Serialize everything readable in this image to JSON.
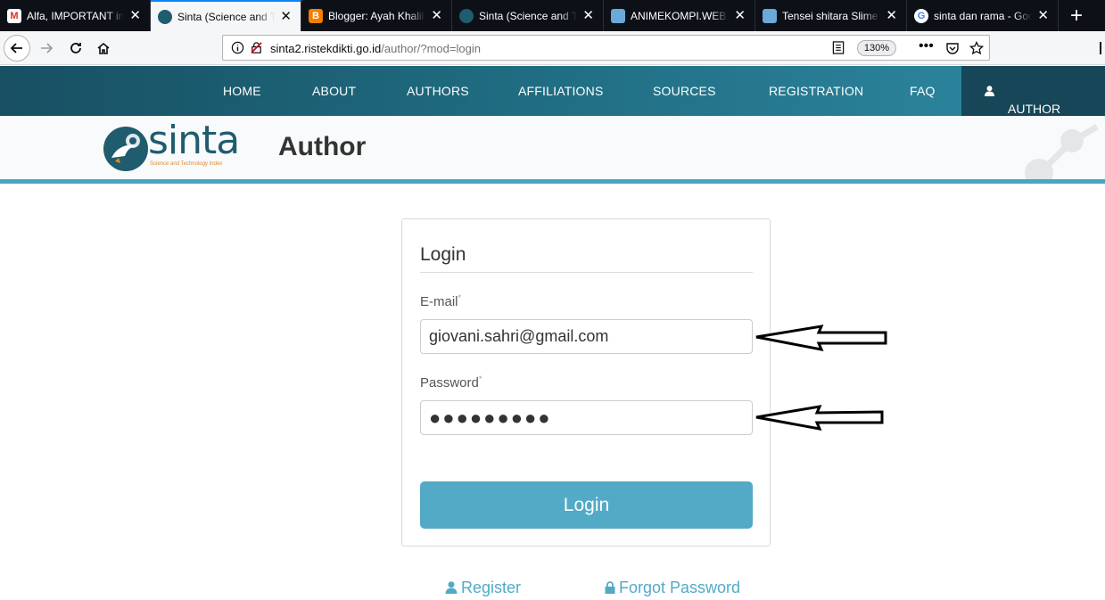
{
  "browser": {
    "tabs": [
      {
        "title": "Alfa, IMPORTANT in",
        "favicon": "gmail-icon",
        "active": false
      },
      {
        "title": "Sinta (Science and Te",
        "favicon": "sinta-icon",
        "active": true
      },
      {
        "title": "Blogger: Ayah Khalil",
        "favicon": "blogger-icon",
        "active": false
      },
      {
        "title": "Sinta (Science and Te",
        "favicon": "sinta-icon",
        "active": false
      },
      {
        "title": "ANIMEKOMPI.WEB.ID",
        "favicon": "site-icon",
        "active": false
      },
      {
        "title": "Tensei shitara Slime D",
        "favicon": "site-icon",
        "active": false
      },
      {
        "title": "sinta dan rama - Goo",
        "favicon": "google-icon",
        "active": false
      }
    ],
    "url_domain": "sinta2.ristekdikti.go.id",
    "url_path": "/author/?mod=login",
    "zoom": "130%"
  },
  "site": {
    "nav": [
      "HOME",
      "ABOUT",
      "AUTHORS",
      "AFFILIATIONS",
      "SOURCES",
      "REGISTRATION",
      "FAQ"
    ],
    "author_login": "AUTHOR LOGIN",
    "logo_text": "sinta",
    "logo_sub": "Science and Technology Index",
    "page_title": "Author"
  },
  "login": {
    "heading": "Login",
    "email_label": "E-mail",
    "email_value": "giovani.sahri@gmail.com",
    "password_label": "Password",
    "password_value": "●●●●●●●●●",
    "required_mark": "*",
    "button": "Login"
  },
  "links": {
    "register": "Register",
    "forgot": "Forgot Password"
  },
  "colors": {
    "accent": "#52aac7",
    "nav_dark": "#164657",
    "brand": "#1f5c6e"
  }
}
